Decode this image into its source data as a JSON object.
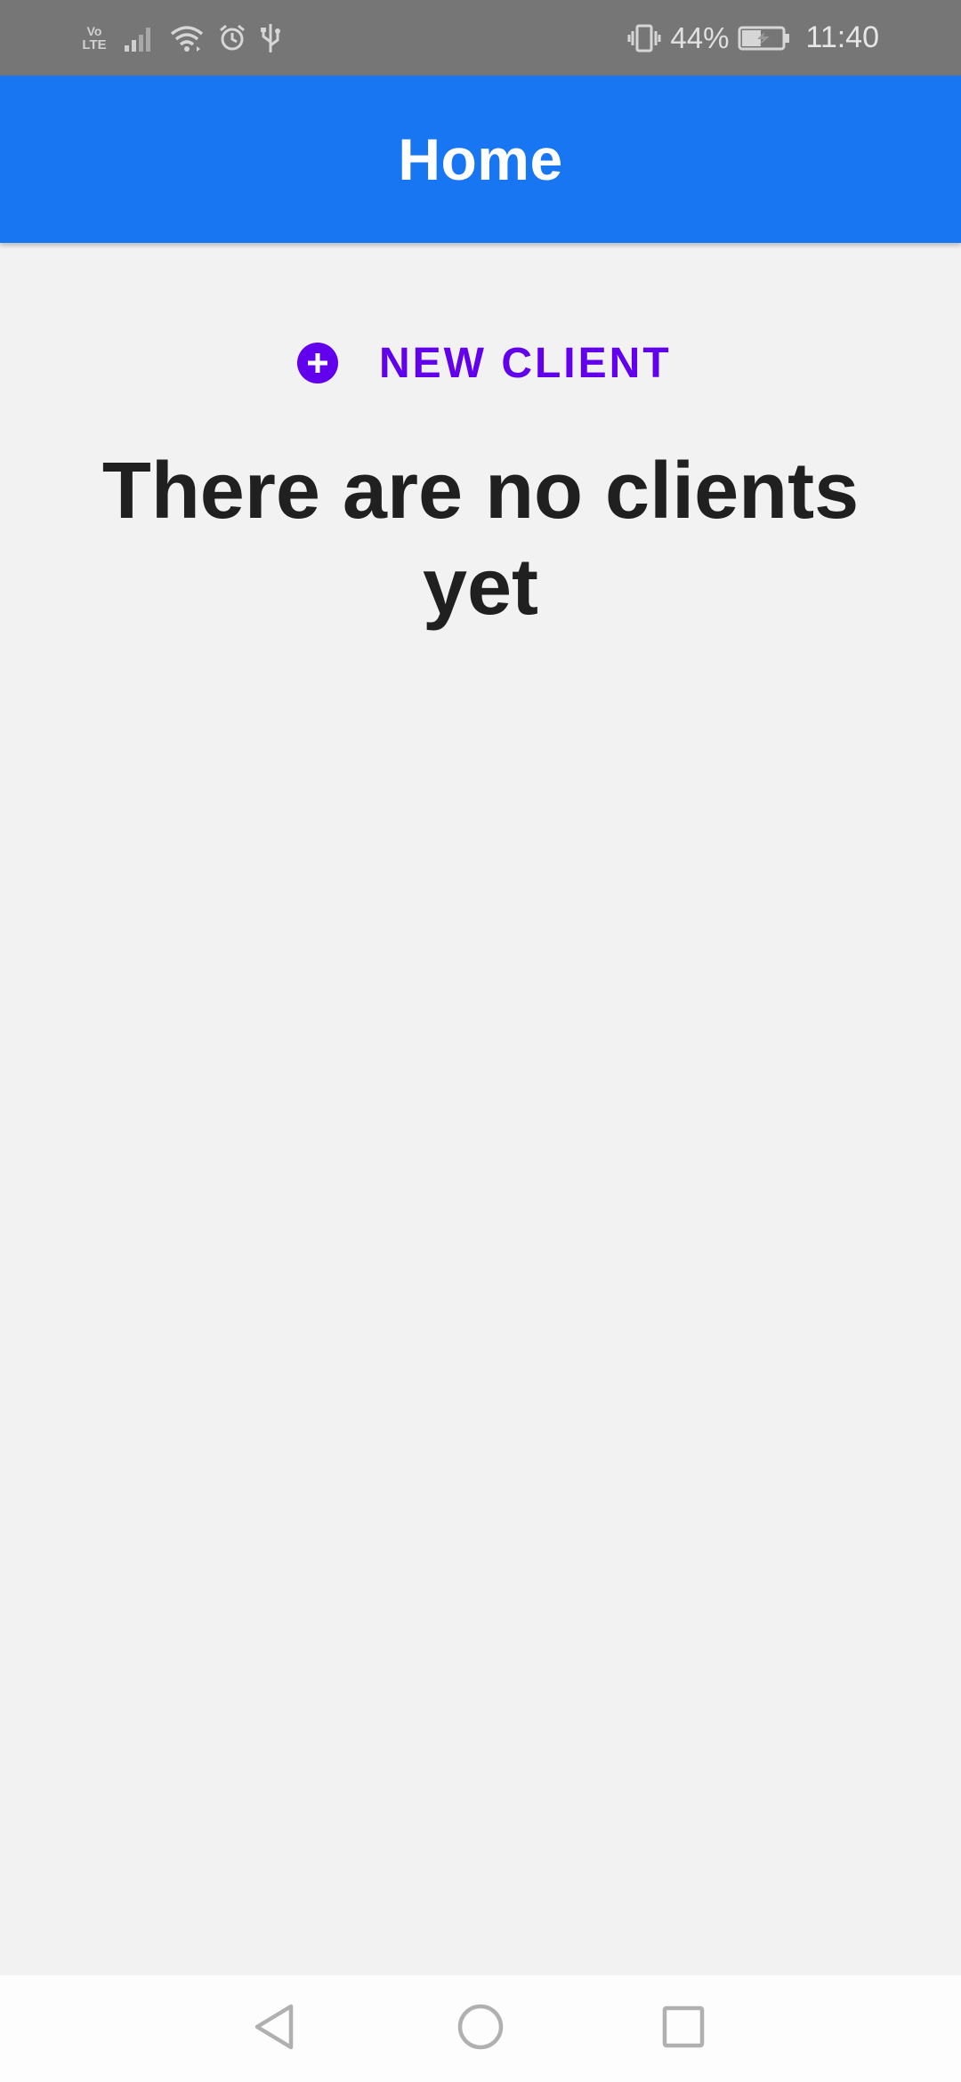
{
  "status_bar": {
    "volte_top": "Vo",
    "volte_bottom": "LTE",
    "battery_percent": "44%",
    "time": "11:40",
    "icons": [
      "volte-icon",
      "signal-icon",
      "wifi-icon",
      "alarm-icon",
      "usb-icon",
      "vibrate-icon",
      "battery-charging-icon"
    ]
  },
  "app_bar": {
    "title": "Home",
    "color": "#1976f2"
  },
  "main": {
    "new_client_label": "NEW CLIENT",
    "new_client_icon": "add-circle-icon",
    "accent_color": "#6200ee",
    "empty_message": "There are no clients yet"
  },
  "nav_bar": {
    "icons": [
      "back-icon",
      "home-icon",
      "recents-icon"
    ]
  }
}
